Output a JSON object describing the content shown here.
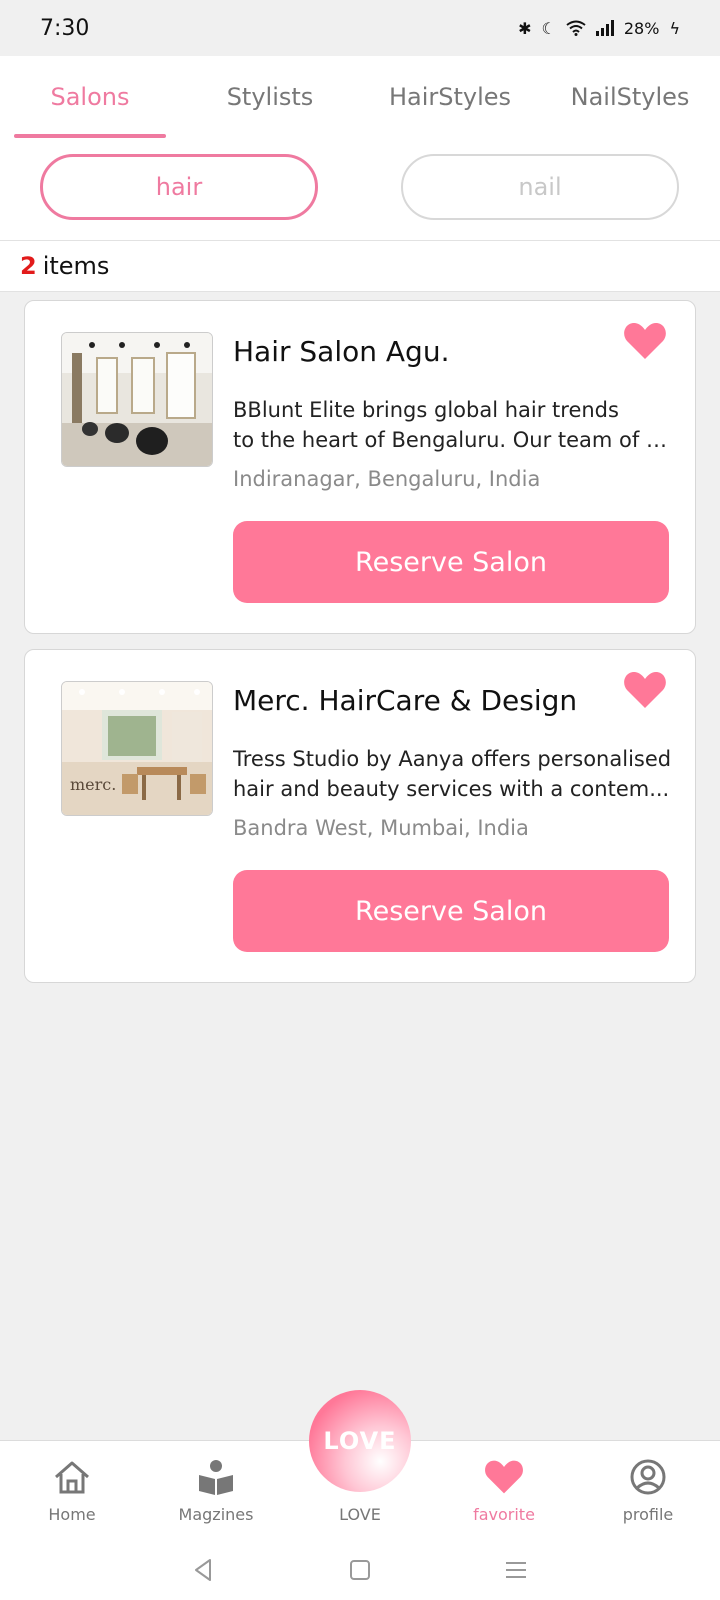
{
  "status_bar": {
    "time": "7:30",
    "battery": "28%"
  },
  "tabs": [
    {
      "label": "Salons"
    },
    {
      "label": "Stylists"
    },
    {
      "label": "HairStyles"
    },
    {
      "label": "NailStyles"
    }
  ],
  "filters": {
    "hair": "hair",
    "nail": "nail"
  },
  "results": {
    "count": "2",
    "label": "items"
  },
  "salons": [
    {
      "name": "Hair Salon Agu.",
      "desc_line1": "BBlunt Elite brings global hair trends",
      "desc_line2": "to the heart of Bengaluru. Our team of e...",
      "location": "Indiranagar, Bengaluru, India",
      "button": "Reserve Salon",
      "favorited": true
    },
    {
      "name": "Merc. HairCare & Design",
      "desc_line1": "Tress Studio by Aanya offers personalised",
      "desc_line2": "hair and beauty services with a contem...",
      "location": "Bandra West, Mumbai, India",
      "button": "Reserve Salon",
      "image_text": "merc.",
      "favorited": true
    }
  ],
  "bottom_nav": {
    "home": "Home",
    "magazines": "Magzines",
    "love": "LOVE",
    "love_fab": "LOVE",
    "favorite": "favorite",
    "profile": "profile"
  },
  "colors": {
    "accent": "#ef7aa0",
    "button": "#ff7898",
    "count": "#e21b1b"
  }
}
